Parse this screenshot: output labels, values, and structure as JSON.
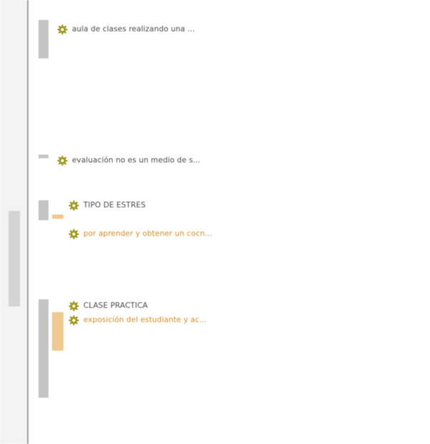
{
  "colors": {
    "bar_gray": "#c4c4c4",
    "bar_orange": "#f0c98e",
    "text_gray": "#4a4a4a",
    "text_orange": "#d98b23",
    "icon_yellow": "#f6ea2a"
  },
  "codes": [
    {
      "id": "c1",
      "label": "aula de clases realizando una ...",
      "color": "gray",
      "icon": "code-star-icon"
    },
    {
      "id": "c2",
      "label": "evaluación no es un medio de s...",
      "color": "gray",
      "icon": "code-star-icon"
    },
    {
      "id": "c3",
      "label": "TIPO DE ESTRES",
      "color": "gray",
      "icon": "code-star-icon"
    },
    {
      "id": "c4",
      "label": "por aprender y obtener un cocn...",
      "color": "orange",
      "icon": "code-star-icon"
    },
    {
      "id": "c5",
      "label": "CLASE PRACTICA",
      "color": "gray",
      "icon": "code-star-icon"
    },
    {
      "id": "c6",
      "label": "exposición del estudiante y ac...",
      "color": "orange",
      "icon": "code-star-icon"
    }
  ]
}
